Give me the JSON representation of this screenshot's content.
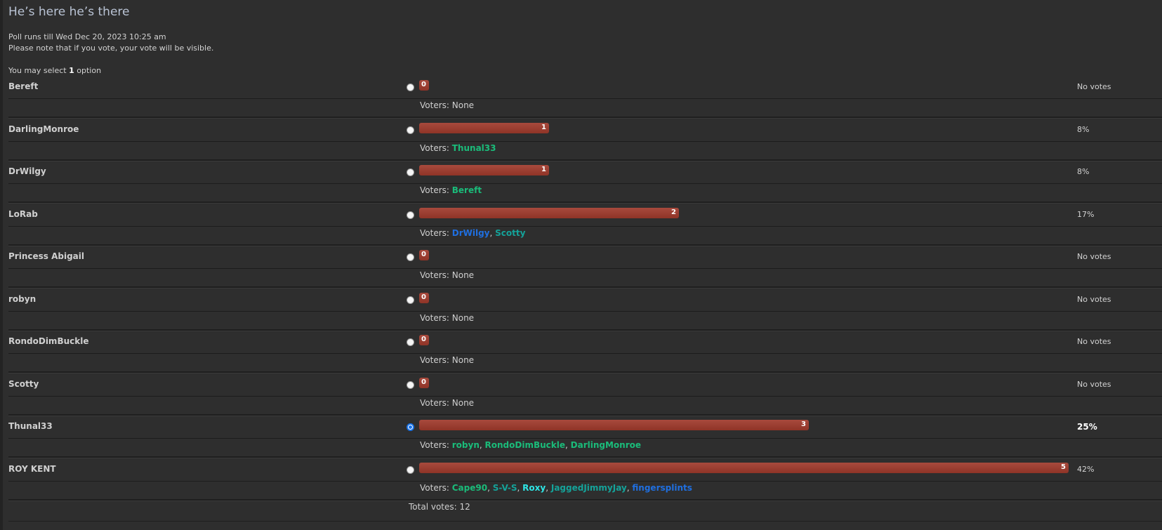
{
  "poll": {
    "title": "He’s here he’s there",
    "runs_till": "Poll runs till Wed Dec 20, 2023 10:25 am",
    "visibility_note": "Please note that if you vote, your vote will be visible.",
    "select_prefix": "You may select ",
    "select_count": "1",
    "select_suffix": " option",
    "voters_label": "Voters: ",
    "total_votes": "Total votes: 12",
    "max_votes": 5,
    "options": [
      {
        "name": "Bereft",
        "votes": 0,
        "count_label": "0",
        "percent": "No votes",
        "checked": false,
        "voters": [
          {
            "name": "None",
            "color": "#cfcfcf",
            "plain": true
          }
        ]
      },
      {
        "name": "DarlingMonroe",
        "votes": 1,
        "count_label": "1",
        "percent": "8%",
        "checked": false,
        "voters": [
          {
            "name": "Thunal33",
            "color": "#1abc7a"
          }
        ]
      },
      {
        "name": "DrWilgy",
        "votes": 1,
        "count_label": "1",
        "percent": "8%",
        "checked": false,
        "voters": [
          {
            "name": "Bereft",
            "color": "#1abc7a"
          }
        ]
      },
      {
        "name": "LoRab",
        "votes": 2,
        "count_label": "2",
        "percent": "17%",
        "checked": false,
        "voters": [
          {
            "name": "DrWilgy",
            "color": "#1f6fe0"
          },
          {
            "name": "Scotty",
            "color": "#14a39a"
          }
        ]
      },
      {
        "name": "Princess Abigail",
        "votes": 0,
        "count_label": "0",
        "percent": "No votes",
        "checked": false,
        "voters": [
          {
            "name": "None",
            "color": "#cfcfcf",
            "plain": true
          }
        ]
      },
      {
        "name": "robyn",
        "votes": 0,
        "count_label": "0",
        "percent": "No votes",
        "checked": false,
        "voters": [
          {
            "name": "None",
            "color": "#cfcfcf",
            "plain": true
          }
        ]
      },
      {
        "name": "RondoDimBuckle",
        "votes": 0,
        "count_label": "0",
        "percent": "No votes",
        "checked": false,
        "voters": [
          {
            "name": "None",
            "color": "#cfcfcf",
            "plain": true
          }
        ]
      },
      {
        "name": "Scotty",
        "votes": 0,
        "count_label": "0",
        "percent": "No votes",
        "checked": false,
        "voters": [
          {
            "name": "None",
            "color": "#cfcfcf",
            "plain": true
          }
        ]
      },
      {
        "name": "Thunal33",
        "votes": 3,
        "count_label": "3",
        "percent": "25%",
        "checked": true,
        "bold_percent": true,
        "voters": [
          {
            "name": "robyn",
            "color": "#1abc7a"
          },
          {
            "name": "RondoDimBuckle",
            "color": "#1abc7a"
          },
          {
            "name": "DarlingMonroe",
            "color": "#1abc7a"
          }
        ]
      },
      {
        "name": "ROY KENT",
        "votes": 5,
        "count_label": "5",
        "percent": "42%",
        "checked": false,
        "voters": [
          {
            "name": "Cape90",
            "color": "#1abc7a"
          },
          {
            "name": "S-V-S",
            "color": "#14a39a"
          },
          {
            "name": "Roxy",
            "color": "#2ee6e6"
          },
          {
            "name": "JaggedJimmyJay",
            "color": "#14a39a"
          },
          {
            "name": "fingersplints",
            "color": "#1f6fe0"
          }
        ]
      }
    ]
  }
}
